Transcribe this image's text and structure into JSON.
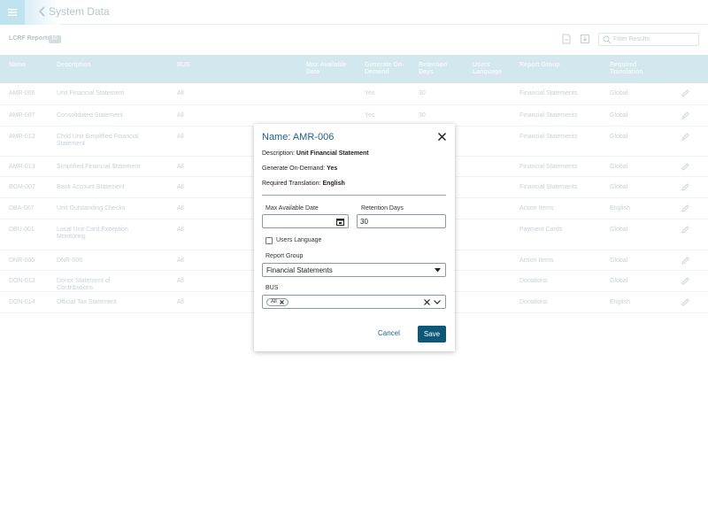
{
  "app": {
    "page_title": "System Data",
    "icons": {
      "menu": "hamburger-icon",
      "back": "chevron-left-icon"
    }
  },
  "report": {
    "title": "LCRF Reports",
    "count": "10",
    "filter_placeholder": "Filter Results",
    "tool_icons": [
      "export-document-icon",
      "download-icon",
      "search-icon"
    ]
  },
  "table": {
    "headers": {
      "name": "Name",
      "description": "Description",
      "bus": "BUS",
      "max_available_date": "Max Available Date",
      "generate_on_demand": "Generate On-Demand",
      "retention_days": "Retention Days",
      "users_language": "Users Language",
      "report_group": "Report Group",
      "required_translation": "Required Translation"
    },
    "rows": [
      {
        "name": "AMR-006",
        "description": "Unit Financial Statement",
        "bus": "All",
        "generate": "Yes",
        "retention": "30",
        "group": "Financial Statements",
        "translation": "Global"
      },
      {
        "name": "AMR-007",
        "description": "Consolidated Statement",
        "bus": "All",
        "generate": "Yes",
        "retention": "30",
        "group": "Financial Statements",
        "translation": "Global"
      },
      {
        "name": "AMR-012",
        "description": "Child Unit Simplified Financial Statement",
        "bus": "All",
        "generate": "",
        "retention": "",
        "group": "Financial Statements",
        "translation": "Global"
      },
      {
        "name": "AMR-013",
        "description": "Simplified Financial Statement",
        "bus": "All",
        "generate": "",
        "retention": "",
        "group": "Financial Statements",
        "translation": "Global"
      },
      {
        "name": "BOM-007",
        "description": "Bank Account Statement",
        "bus": "All",
        "generate": "",
        "retention": "",
        "group": "Financial Statements",
        "translation": "Global"
      },
      {
        "name": "DBA-007",
        "description": "Unit Outstanding Checks",
        "bus": "All",
        "generate": "",
        "retention": "",
        "group": "Action Items",
        "translation": "English"
      },
      {
        "name": "DBU-001",
        "description": "Local Unit Card Exception Monitoring",
        "bus": "All",
        "generate": "",
        "retention": "",
        "group": "Payment Cards",
        "translation": "Global"
      },
      {
        "name": "DNR-006",
        "description": "DNR-006",
        "bus": "All",
        "generate": "",
        "retention": "",
        "group": "Action Items",
        "translation": "Global"
      },
      {
        "name": "DON-012",
        "description": "Donor Statement of Contributions",
        "bus": "All",
        "generate": "",
        "retention": "",
        "group": "Donations",
        "translation": "Global"
      },
      {
        "name": "DON-014",
        "description": "Official Tax Statement",
        "bus": "All",
        "generate": "",
        "retention": "",
        "group": "Donations",
        "translation": "English"
      }
    ]
  },
  "modal": {
    "title": "Name: AMR-006",
    "description_label": "Description:",
    "description_value": "Unit Financial Statement",
    "generate_label": "Generate On-Demand:",
    "generate_value": "Yes",
    "translation_label": "Required Translation:",
    "translation_value": "English",
    "max_date_label": "Max Available Date",
    "max_date_value": "",
    "retention_label": "Retention Days",
    "retention_value": "30",
    "users_language_label": "Users Language",
    "users_language_checked": false,
    "report_group_label": "Report Group",
    "report_group_value": "Financial Statements",
    "bus_label": "BUS",
    "bus_chip": "All",
    "cancel_label": "Cancel",
    "save_label": "Save",
    "colors": {
      "accent": "#1f5f8b",
      "save_button": "#0d5778",
      "header_bg": "#d3e7ee"
    }
  }
}
